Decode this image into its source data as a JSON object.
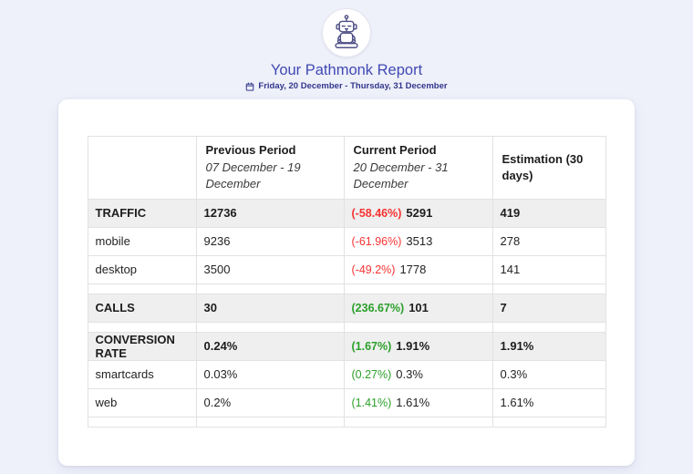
{
  "page": {
    "background": "#eef0fa"
  },
  "header": {
    "logo": "pathmonk-robot",
    "title": "Your Pathmonk Report",
    "date_range": "Friday, 20 December - Thursday, 31 December"
  },
  "colors": {
    "accent": "#4149b2",
    "date_text": "#32368b",
    "negative": "#f83333",
    "positive": "#2ba02b",
    "section_row_bg": "#efefef",
    "border": "#e2e2e2"
  },
  "table": {
    "columns": [
      {
        "title": "",
        "subtitle": ""
      },
      {
        "title": "Previous Period",
        "subtitle": "07 December - 19 December"
      },
      {
        "title": "Current Period",
        "subtitle": "20 December - 31 December"
      },
      {
        "title": "Estimation (30 days)",
        "subtitle": ""
      }
    ],
    "rows": [
      {
        "type": "section",
        "label": "TRAFFIC",
        "previous": "12736",
        "change": "(-58.46%)",
        "change_dir": "negative",
        "current": "5291",
        "estimation": "419"
      },
      {
        "type": "item",
        "label": "mobile",
        "previous": "9236",
        "change": "(-61.96%)",
        "change_dir": "negative",
        "current": "3513",
        "estimation": "278"
      },
      {
        "type": "item",
        "label": "desktop",
        "previous": "3500",
        "change": "(-49.2%)",
        "change_dir": "negative",
        "current": "1778",
        "estimation": "141"
      },
      {
        "type": "spacer"
      },
      {
        "type": "section",
        "label": "CALLS",
        "previous": "30",
        "change": "(236.67%)",
        "change_dir": "positive",
        "current": "101",
        "estimation": "7"
      },
      {
        "type": "spacer"
      },
      {
        "type": "section",
        "label": "CONVERSION RATE",
        "previous": "0.24%",
        "change": "(1.67%)",
        "change_dir": "positive",
        "current": "1.91%",
        "estimation": "1.91%"
      },
      {
        "type": "item",
        "label": "smartcards",
        "previous": "0.03%",
        "change": "(0.27%)",
        "change_dir": "positive",
        "current": "0.3%",
        "estimation": "0.3%"
      },
      {
        "type": "item",
        "label": "web",
        "previous": "0.2%",
        "change": "(1.41%)",
        "change_dir": "positive",
        "current": "1.61%",
        "estimation": "1.61%"
      },
      {
        "type": "spacer"
      }
    ]
  }
}
